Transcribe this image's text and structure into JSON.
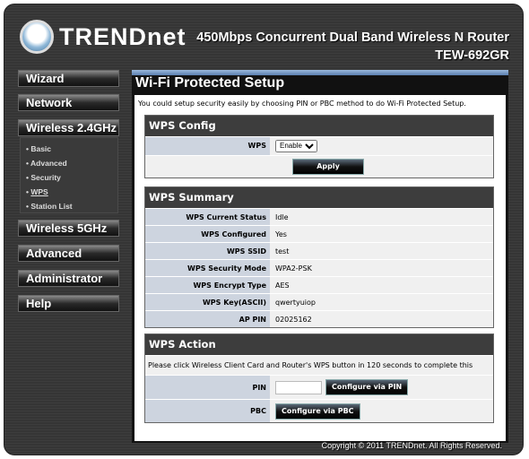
{
  "header": {
    "logo": "TRENDnet",
    "product": "450Mbps Concurrent Dual Band Wireless N Router",
    "model": "TEW-692GR"
  },
  "sidebar": {
    "items": [
      {
        "label": "Wizard"
      },
      {
        "label": "Network"
      },
      {
        "label": "Wireless 2.4GHz"
      },
      {
        "label": "Wireless 5GHz"
      },
      {
        "label": "Advanced"
      },
      {
        "label": "Administrator"
      },
      {
        "label": "Help"
      }
    ],
    "submenu": [
      "Basic",
      "Advanced",
      "Security",
      "WPS",
      "Station List"
    ],
    "active_sub": "WPS"
  },
  "page": {
    "title": "Wi-Fi Protected Setup",
    "intro": "You could setup security easily by choosing PIN or PBC method to do Wi-Fi Protected Setup."
  },
  "config": {
    "title": "WPS Config",
    "wps_label": "WPS",
    "wps_value": "Enable",
    "apply": "Apply"
  },
  "summary": {
    "title": "WPS Summary",
    "rows": [
      {
        "label": "WPS Current Status",
        "value": "Idle"
      },
      {
        "label": "WPS Configured",
        "value": "Yes"
      },
      {
        "label": "WPS SSID",
        "value": "test"
      },
      {
        "label": "WPS Security Mode",
        "value": "WPA2-PSK"
      },
      {
        "label": "WPS Encrypt Type",
        "value": "AES"
      },
      {
        "label": "WPS Key(ASCII)",
        "value": "qwertyuiop"
      },
      {
        "label": "AP PIN",
        "value": "02025162"
      }
    ]
  },
  "action": {
    "title": "WPS Action",
    "note": "Please click Wireless Client Card and Router's WPS button in 120 seconds to complete this setting.",
    "pin_label": "PIN",
    "pin_value": "",
    "pin_button": "Configure via PIN",
    "pbc_label": "PBC",
    "pbc_button": "Configure via PBC"
  },
  "footer": {
    "copyright": "Copyright © 2011 TRENDnet. All Rights Reserved."
  }
}
